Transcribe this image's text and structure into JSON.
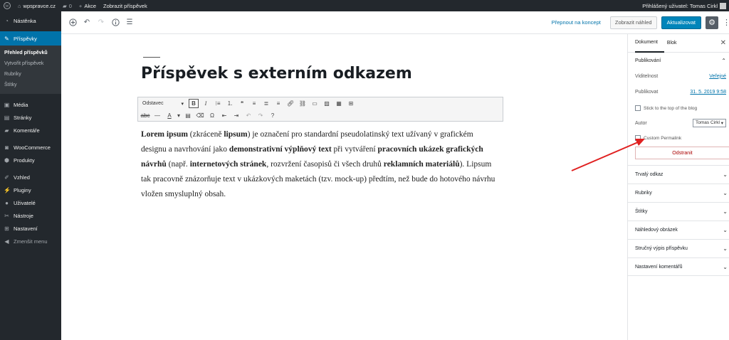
{
  "adminbar": {
    "site_name": "wpspravce.cz",
    "comments_count": "0",
    "new_label": "Akce",
    "view_post_label": "Zobrazit příspěvek",
    "user_greeting": "Přihlášený uživatel: Tomas Cirkl"
  },
  "sidebar": {
    "items": [
      {
        "label": "Nástěnka",
        "icon": "dashboard-icon"
      },
      {
        "label": "Příspěvky",
        "icon": "pin-icon"
      },
      {
        "label": "Média",
        "icon": "media-icon"
      },
      {
        "label": "Stránky",
        "icon": "pages-icon"
      },
      {
        "label": "Komentáře",
        "icon": "comments-icon"
      },
      {
        "label": "WooCommerce",
        "icon": "woocommerce-icon"
      },
      {
        "label": "Produkty",
        "icon": "products-icon"
      },
      {
        "label": "Vzhled",
        "icon": "appearance-icon"
      },
      {
        "label": "Pluginy",
        "icon": "plugins-icon"
      },
      {
        "label": "Uživatelé",
        "icon": "users-icon"
      },
      {
        "label": "Nástroje",
        "icon": "tools-icon"
      },
      {
        "label": "Nastavení",
        "icon": "settings-icon"
      },
      {
        "label": "Zmenšit menu",
        "icon": "collapse-icon"
      }
    ],
    "submenu": [
      "Přehled příspěvků",
      "Vytvořit příspěvek",
      "Rubriky",
      "Štítky"
    ]
  },
  "toolbar": {
    "draft_label": "Přepnout na koncept",
    "preview_label": "Zobrazit náhled",
    "update_label": "Aktualizovat"
  },
  "post": {
    "title": "Příspěvek s externím odkazem",
    "format_select": "Odstavec",
    "p1_b1": "Lorem ipsum",
    "p1_t1": " (zkráceně ",
    "p1_b2": "lipsum",
    "p1_t2": ") je označení pro standardní pseudolatinský text užívaný v grafickém designu a navrhování jako ",
    "p1_b3": "demonstrativní výplňový text",
    "p1_t3": " při vytváření ",
    "p1_b4": "pracovních ukázek grafických návrhů",
    "p1_t4": " (např. ",
    "p1_b5": "internetových stránek",
    "p1_t5": ", rozvržení časopisů či všech druhů ",
    "p1_b6": "reklamních materiálů",
    "p1_t6": "). Lipsum tak pracovně znázorňuje text v ukázkových maketách (tzv. mock-up) předtím, než bude do hotového návrhu vložen smysluplný obsah."
  },
  "panel": {
    "tab_document": "Dokument",
    "tab_block": "Blok",
    "publish_heading": "Publikování",
    "visibility_label": "Viditelnost",
    "visibility_value": "Veřejné",
    "publish_label": "Publikovat",
    "publish_value": "31. 5. 2019 9:58",
    "sticky_label": "Stick to the top of the blog",
    "author_label": "Autor",
    "author_value": "Tomas Cirkl",
    "permalink_label": "Custom Permalink",
    "delete_label": "Odstranit",
    "sections": [
      "Trvalý odkaz",
      "Rubriky",
      "Štítky",
      "Náhledový obrázek",
      "Stručný výpis příspěvku",
      "Nastavení komentářů"
    ]
  },
  "colors": {
    "admin_dark": "#23282d",
    "accent": "#0073aa",
    "annotation_arrow": "#e02020"
  }
}
